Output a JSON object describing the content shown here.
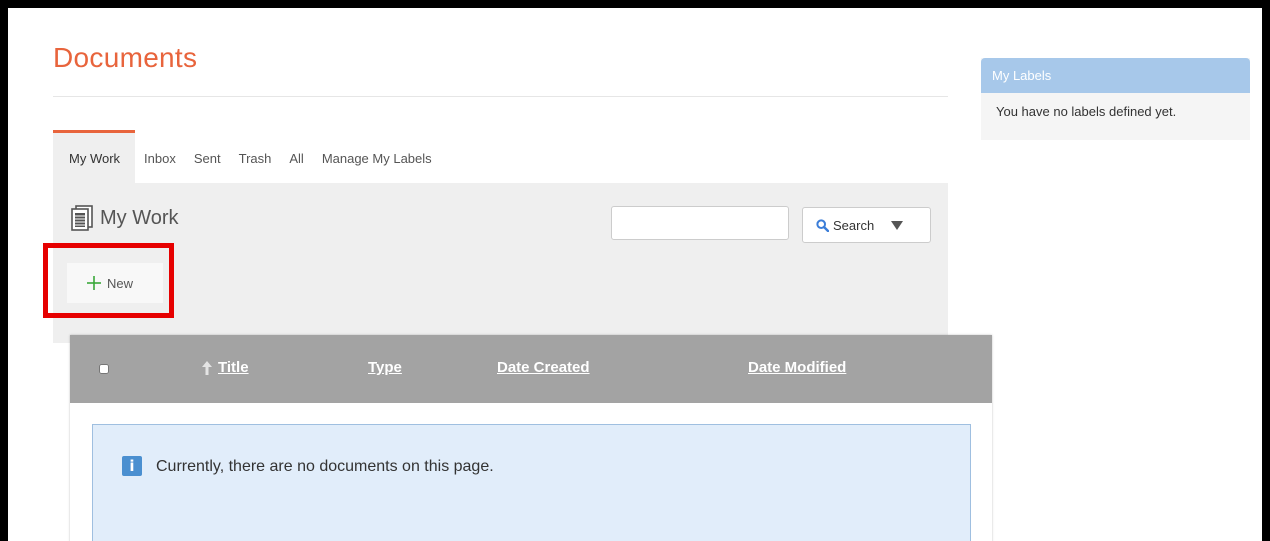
{
  "page": {
    "title": "Documents"
  },
  "tabs": [
    {
      "label": "My Work",
      "active": true
    },
    {
      "label": "Inbox",
      "active": false
    },
    {
      "label": "Sent",
      "active": false
    },
    {
      "label": "Trash",
      "active": false
    },
    {
      "label": "All",
      "active": false
    },
    {
      "label": "Manage My Labels",
      "active": false
    }
  ],
  "panel": {
    "title": "My Work",
    "icon": "documents-icon",
    "search": {
      "value": "",
      "placeholder": "",
      "button_label": "Search",
      "icon": "magnifier-icon"
    },
    "new_button": {
      "label": "New",
      "icon": "plus-icon"
    }
  },
  "table": {
    "columns": [
      {
        "label": "Title",
        "sorted": "ascending"
      },
      {
        "label": "Type"
      },
      {
        "label": "Date Created"
      },
      {
        "label": "Date Modified"
      }
    ],
    "rows": [],
    "empty_message": "Currently, there are no documents on this page.",
    "empty_icon": "info-icon"
  },
  "labels_widget": {
    "title": "My Labels",
    "empty_message": "You have no labels defined yet."
  },
  "colors": {
    "accent": "#e8643c",
    "table_header": "#a3a3a3",
    "info_background": "#e1edfa",
    "info_icon": "#4a8fd0",
    "labels_header": "#a7c8ea",
    "highlight": "#e60000",
    "plus": "#3aa83a"
  }
}
